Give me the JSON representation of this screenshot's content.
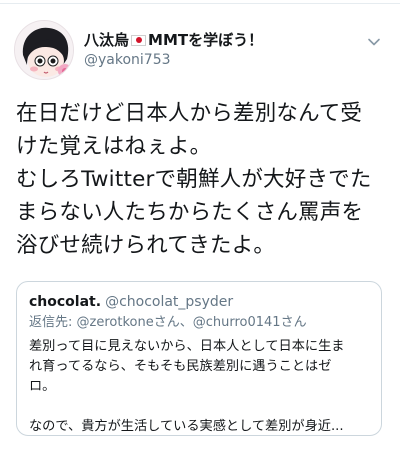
{
  "tweet": {
    "author": {
      "name_prefix": "八汰烏",
      "flag_icon": "japan-flag-icon",
      "name_suffix": "MMTを学ぼう！",
      "handle": "@yakoni753"
    },
    "menu_icon": "chevron-down-icon",
    "text_lines": [
      "在日だけど日本人から差別なんて受",
      "けた覚えはねぇよ。",
      "むしろTwitterで朝鮮人が大好きでた",
      "まらない人たちからたくさん罵声を",
      "浴びせ続けられてきたよ。"
    ]
  },
  "quoted_tweet": {
    "name": "chocolat.",
    "handle": "@chocolat_psyder",
    "reply_label": "返信先:",
    "reply_mention_1": "@zerotkone",
    "reply_san_1": "さん、",
    "reply_mention_2": "@churro0141",
    "reply_san_2": "さん",
    "body_lines": [
      "差別って目に見えないから、日本人として日本に生ま",
      "れ育ってるなら、そもそも民族差別に遇うことはゼ",
      "ロ。",
      "",
      "なので、貴方が生活している実感として差別が身近..."
    ]
  },
  "colors": {
    "text": "#14171a",
    "secondary": "#657786",
    "border": "#ccd6dd"
  }
}
